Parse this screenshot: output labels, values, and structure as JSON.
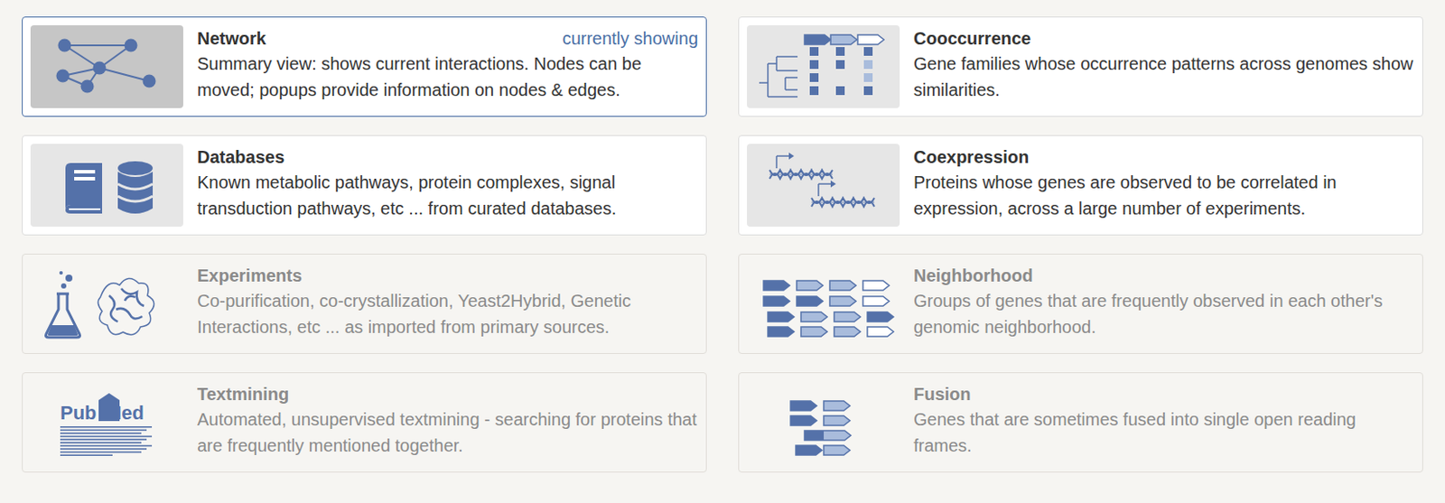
{
  "cards": [
    {
      "kind": "network",
      "title": "Network",
      "description": "Summary view: shows current interactions. Nodes can be moved; popups provide information on nodes & edges.",
      "selected": true,
      "disabled": false,
      "badge": "currently showing"
    },
    {
      "kind": "cooccurrence",
      "title": "Cooccurrence",
      "description": "Gene families whose occurrence patterns across genomes show similarities.",
      "selected": false,
      "disabled": false
    },
    {
      "kind": "databases",
      "title": "Databases",
      "description": "Known metabolic pathways, protein complexes, signal transduction pathways, etc ... from curated databases.",
      "selected": false,
      "disabled": false
    },
    {
      "kind": "coexpression",
      "title": "Coexpression",
      "description": "Proteins whose genes are observed to be correlated in expression, across a large number of experiments.",
      "selected": false,
      "disabled": false
    },
    {
      "kind": "experiments",
      "title": "Experiments",
      "description": "Co-purification, co-crystallization, Yeast2Hybrid, Genetic Interactions, etc ... as imported from primary sources.",
      "selected": false,
      "disabled": true
    },
    {
      "kind": "neighborhood",
      "title": "Neighborhood",
      "description": "Groups of genes that are frequently observed in each other's genomic neighborhood.",
      "selected": false,
      "disabled": true
    },
    {
      "kind": "textmining",
      "title": "Textmining",
      "description": "Automated, unsupervised textmining - searching for proteins that are frequently mentioned together.",
      "selected": false,
      "disabled": true,
      "logo": [
        "Pub",
        "Med"
      ]
    },
    {
      "kind": "fusion",
      "title": "Fusion",
      "description": "Genes that are sometimes fused into single open reading frames.",
      "selected": false,
      "disabled": true
    }
  ]
}
